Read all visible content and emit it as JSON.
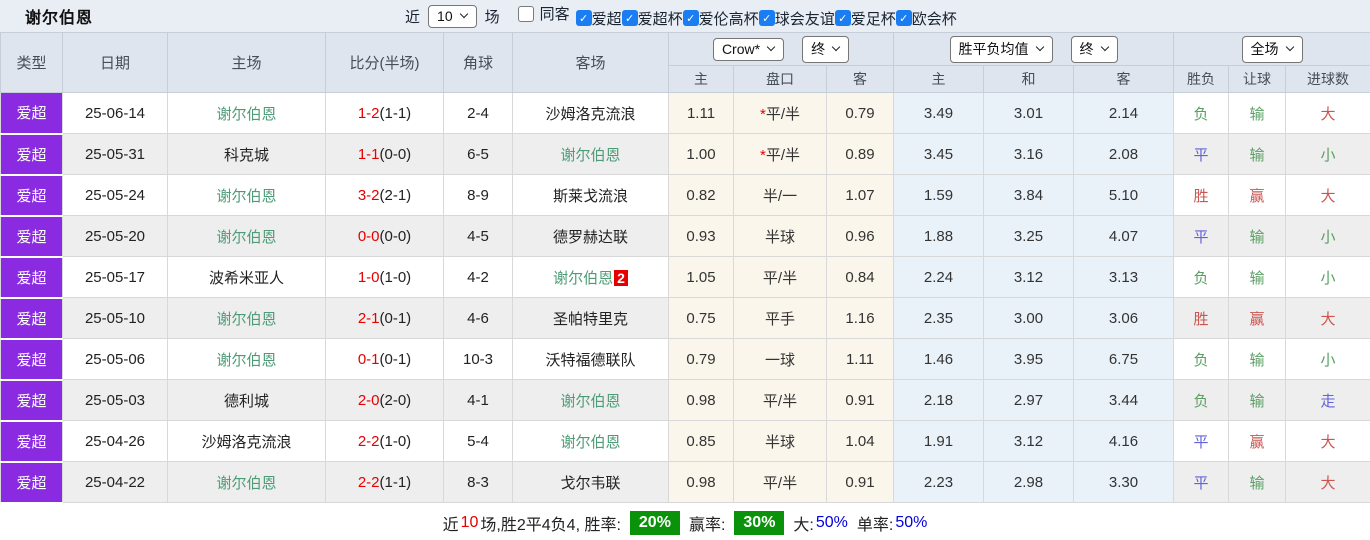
{
  "toolbar": {
    "title": "谢尔伯恩",
    "near_label": "近",
    "matches_select": "10",
    "field_label": "场",
    "checkboxes": [
      {
        "label": "同客",
        "checked": false
      },
      {
        "label": "爱超",
        "checked": true
      },
      {
        "label": "爱超杯",
        "checked": true
      },
      {
        "label": "爱伦高杯",
        "checked": true
      },
      {
        "label": "球会友谊",
        "checked": true
      },
      {
        "label": "爱足杯",
        "checked": true
      },
      {
        "label": "欧会杯",
        "checked": true
      }
    ]
  },
  "header": {
    "selects": {
      "odds_company": "Crow*",
      "odds_time": "终",
      "avg": "胜平负均值",
      "avg_time": "终",
      "scope": "全场"
    },
    "columns": [
      "类型",
      "日期",
      "主场",
      "比分(半场)",
      "角球",
      "客场"
    ],
    "sub_columns": [
      "主",
      "盘口",
      "客",
      "主",
      "和",
      "客",
      "胜负",
      "让球",
      "进球数"
    ]
  },
  "rows": [
    {
      "type": "爱超",
      "date": "25-06-14",
      "home": "谢尔伯恩",
      "home_team": true,
      "score": "1-2",
      "half": "(1-1)",
      "corner": "2-4",
      "away": "沙姆洛克流浪",
      "away_team": false,
      "away_badge": "",
      "odds_home": "1.11",
      "handicap": "平/半",
      "star": true,
      "odds_away": "0.79",
      "avg": [
        "3.49",
        "3.01",
        "2.14"
      ],
      "result": {
        "text": "负",
        "cls": "c-green"
      },
      "let": {
        "text": "输",
        "cls": "c-green"
      },
      "goal": {
        "text": "大",
        "cls": "c-red"
      }
    },
    {
      "type": "爱超",
      "date": "25-05-31",
      "home": "科克城",
      "home_team": false,
      "score": "1-1",
      "half": "(0-0)",
      "corner": "6-5",
      "away": "谢尔伯恩",
      "away_team": true,
      "away_badge": "",
      "odds_home": "1.00",
      "handicap": "平/半",
      "star": true,
      "odds_away": "0.89",
      "avg": [
        "3.45",
        "3.16",
        "2.08"
      ],
      "result": {
        "text": "平",
        "cls": "c-blue"
      },
      "let": {
        "text": "输",
        "cls": "c-green"
      },
      "goal": {
        "text": "小",
        "cls": "c-green"
      }
    },
    {
      "type": "爱超",
      "date": "25-05-24",
      "home": "谢尔伯恩",
      "home_team": true,
      "score": "3-2",
      "half": "(2-1)",
      "corner": "8-9",
      "away": "斯莱戈流浪",
      "away_team": false,
      "away_badge": "",
      "odds_home": "0.82",
      "handicap": "半/一",
      "star": false,
      "odds_away": "1.07",
      "avg": [
        "1.59",
        "3.84",
        "5.10"
      ],
      "result": {
        "text": "胜",
        "cls": "c-red"
      },
      "let": {
        "text": "赢",
        "cls": "c-red"
      },
      "goal": {
        "text": "大",
        "cls": "c-red"
      }
    },
    {
      "type": "爱超",
      "date": "25-05-20",
      "home": "谢尔伯恩",
      "home_team": true,
      "score": "0-0",
      "half": "(0-0)",
      "corner": "4-5",
      "away": "德罗赫达联",
      "away_team": false,
      "away_badge": "",
      "odds_home": "0.93",
      "handicap": "半球",
      "star": false,
      "odds_away": "0.96",
      "avg": [
        "1.88",
        "3.25",
        "4.07"
      ],
      "result": {
        "text": "平",
        "cls": "c-blue"
      },
      "let": {
        "text": "输",
        "cls": "c-green"
      },
      "goal": {
        "text": "小",
        "cls": "c-green"
      }
    },
    {
      "type": "爱超",
      "date": "25-05-17",
      "home": "波希米亚人",
      "home_team": false,
      "score": "1-0",
      "half": "(1-0)",
      "corner": "4-2",
      "away": "谢尔伯恩",
      "away_team": true,
      "away_badge": "2",
      "odds_home": "1.05",
      "handicap": "平/半",
      "star": false,
      "odds_away": "0.84",
      "avg": [
        "2.24",
        "3.12",
        "3.13"
      ],
      "result": {
        "text": "负",
        "cls": "c-green"
      },
      "let": {
        "text": "输",
        "cls": "c-green"
      },
      "goal": {
        "text": "小",
        "cls": "c-green"
      }
    },
    {
      "type": "爱超",
      "date": "25-05-10",
      "home": "谢尔伯恩",
      "home_team": true,
      "score": "2-1",
      "half": "(0-1)",
      "corner": "4-6",
      "away": "圣帕特里克",
      "away_team": false,
      "away_badge": "",
      "odds_home": "0.75",
      "handicap": "平手",
      "star": false,
      "odds_away": "1.16",
      "avg": [
        "2.35",
        "3.00",
        "3.06"
      ],
      "result": {
        "text": "胜",
        "cls": "c-red"
      },
      "let": {
        "text": "赢",
        "cls": "c-red"
      },
      "goal": {
        "text": "大",
        "cls": "c-red"
      }
    },
    {
      "type": "爱超",
      "date": "25-05-06",
      "home": "谢尔伯恩",
      "home_team": true,
      "score": "0-1",
      "half": "(0-1)",
      "corner": "10-3",
      "away": "沃特福德联队",
      "away_team": false,
      "away_badge": "",
      "odds_home": "0.79",
      "handicap": "一球",
      "star": false,
      "odds_away": "1.11",
      "avg": [
        "1.46",
        "3.95",
        "6.75"
      ],
      "result": {
        "text": "负",
        "cls": "c-green"
      },
      "let": {
        "text": "输",
        "cls": "c-green"
      },
      "goal": {
        "text": "小",
        "cls": "c-green"
      }
    },
    {
      "type": "爱超",
      "date": "25-05-03",
      "home": "德利城",
      "home_team": false,
      "score": "2-0",
      "half": "(2-0)",
      "corner": "4-1",
      "away": "谢尔伯恩",
      "away_team": true,
      "away_badge": "",
      "odds_home": "0.98",
      "handicap": "平/半",
      "star": false,
      "odds_away": "0.91",
      "avg": [
        "2.18",
        "2.97",
        "3.44"
      ],
      "result": {
        "text": "负",
        "cls": "c-green"
      },
      "let": {
        "text": "输",
        "cls": "c-green"
      },
      "goal": {
        "text": "走",
        "cls": "c-blue"
      }
    },
    {
      "type": "爱超",
      "date": "25-04-26",
      "home": "沙姆洛克流浪",
      "home_team": false,
      "score": "2-2",
      "half": "(1-0)",
      "corner": "5-4",
      "away": "谢尔伯恩",
      "away_team": true,
      "away_badge": "",
      "odds_home": "0.85",
      "handicap": "半球",
      "star": false,
      "odds_away": "1.04",
      "avg": [
        "1.91",
        "3.12",
        "4.16"
      ],
      "result": {
        "text": "平",
        "cls": "c-blue"
      },
      "let": {
        "text": "赢",
        "cls": "c-red"
      },
      "goal": {
        "text": "大",
        "cls": "c-red"
      }
    },
    {
      "type": "爱超",
      "date": "25-04-22",
      "home": "谢尔伯恩",
      "home_team": true,
      "score": "2-2",
      "half": "(1-1)",
      "corner": "8-3",
      "away": "戈尔韦联",
      "away_team": false,
      "away_badge": "",
      "odds_home": "0.98",
      "handicap": "平/半",
      "star": false,
      "odds_away": "0.91",
      "avg": [
        "2.23",
        "2.98",
        "3.30"
      ],
      "result": {
        "text": "平",
        "cls": "c-blue"
      },
      "let": {
        "text": "输",
        "cls": "c-green"
      },
      "goal": {
        "text": "大",
        "cls": "c-red"
      }
    }
  ],
  "footer": {
    "near": "近",
    "count": "10",
    "summary": "场,胜2平4负4, 胜率:",
    "win_rate": "20%",
    "handicap_label": "赢率:",
    "handicap_rate": "30%",
    "big_label": "大:",
    "big_rate": "50%",
    "single_label": "单率:",
    "single_rate": "50%"
  },
  "colors": {
    "type_badge_bg": "#8a2be2",
    "team_green": "#4d9c77",
    "score_red": "#e60000",
    "result_win_red": "#cc5550",
    "result_draw_blue": "#6262dd",
    "result_lose_green": "#5a9f63",
    "odds_col_bg": "#fbf6ec",
    "avg_col_bg": "#eaf2f9",
    "rate_box_green": "#0a930a",
    "checkbox_blue": "#1a7ef2"
  }
}
